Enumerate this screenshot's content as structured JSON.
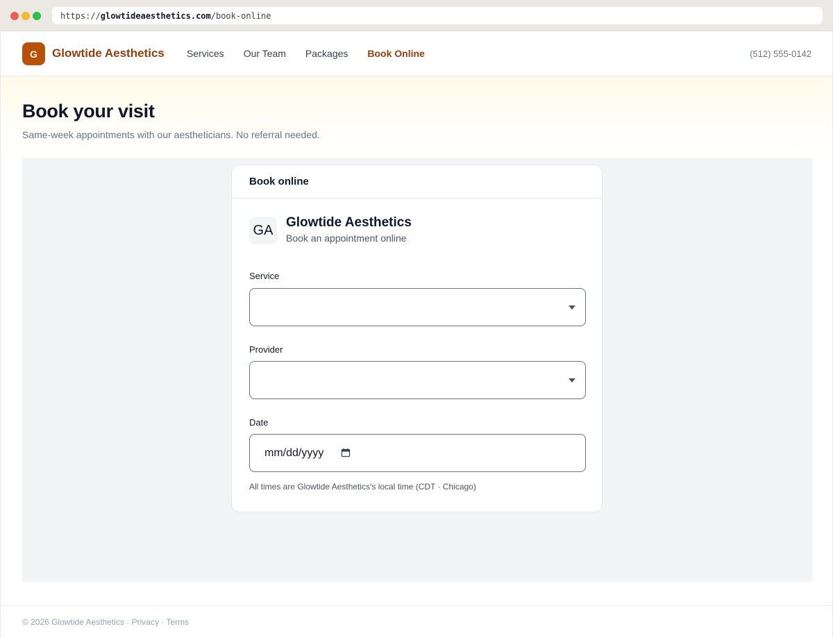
{
  "browser": {
    "url_prefix": "https://",
    "url_domain": "glowtideaesthetics.com",
    "url_path": "/book-online"
  },
  "header": {
    "logo_letter": "G",
    "brand": "Glowtide Aesthetics",
    "nav": [
      "Services",
      "Our Team",
      "Packages",
      "Book Online"
    ],
    "active_nav": "Book Online",
    "phone": "(512) 555-0142"
  },
  "hero": {
    "title": "Book your visit",
    "subtitle": "Same-week appointments with our aestheticians. No referral needed."
  },
  "booking": {
    "card_title": "Book online",
    "business_initials": "GA",
    "business_name": "Glowtide Aesthetics",
    "business_tagline": "Book an appointment online",
    "service_label": "Service",
    "service_value": "",
    "provider_label": "Provider",
    "provider_value": "",
    "date_label": "Date",
    "date_placeholder": "mm/dd/yyyy",
    "timezone_note": "All times are Glowtide Aesthetics's local time (CDT · Chicago)"
  },
  "footer": {
    "copyright": "© 2026 Glowtide Aesthetics",
    "separator": " · ",
    "privacy": "Privacy",
    "terms": "Terms"
  },
  "colors": {
    "brand": "#92400e",
    "logo_bg": "#b45309",
    "panel_bg": "#f3f4f6"
  }
}
